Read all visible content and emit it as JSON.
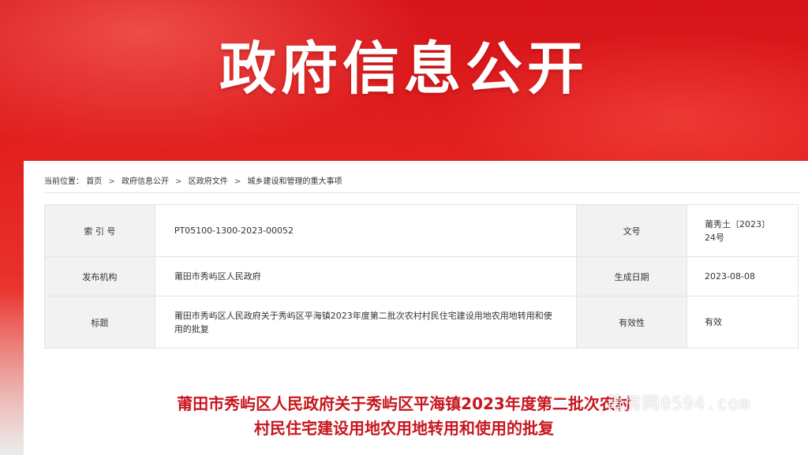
{
  "banner": {
    "title": "政府信息公开"
  },
  "breadcrumb": {
    "prefix": "当前位置：",
    "items": [
      "首页",
      "政府信息公开",
      "区政府文件",
      "城乡建设和管理的重大事项"
    ],
    "separator": ">"
  },
  "meta": {
    "index_label": "索 引 号",
    "index_value": "PT05100-1300-2023-00052",
    "doc_no_label": "文号",
    "doc_no_value": "莆秀土〔2023〕24号",
    "publisher_label": "发布机构",
    "publisher_value": "莆田市秀屿区人民政府",
    "date_label": "生成日期",
    "date_value": "2023-08-08",
    "title_label": "标题",
    "title_value": "莆田市秀屿区人民政府关于秀屿区平海镇2023年度第二批次农村村民住宅建设用地农用地转用和使用的批复",
    "validity_label": "有效性",
    "validity_value": "有效"
  },
  "document": {
    "title_line1": "莆田市秀屿区人民政府关于秀屿区平海镇2023年度第二批次农村",
    "title_line2": "村民住宅建设用地农用地转用和使用的批复"
  },
  "watermark": {
    "text": "莆房网0594.com"
  }
}
